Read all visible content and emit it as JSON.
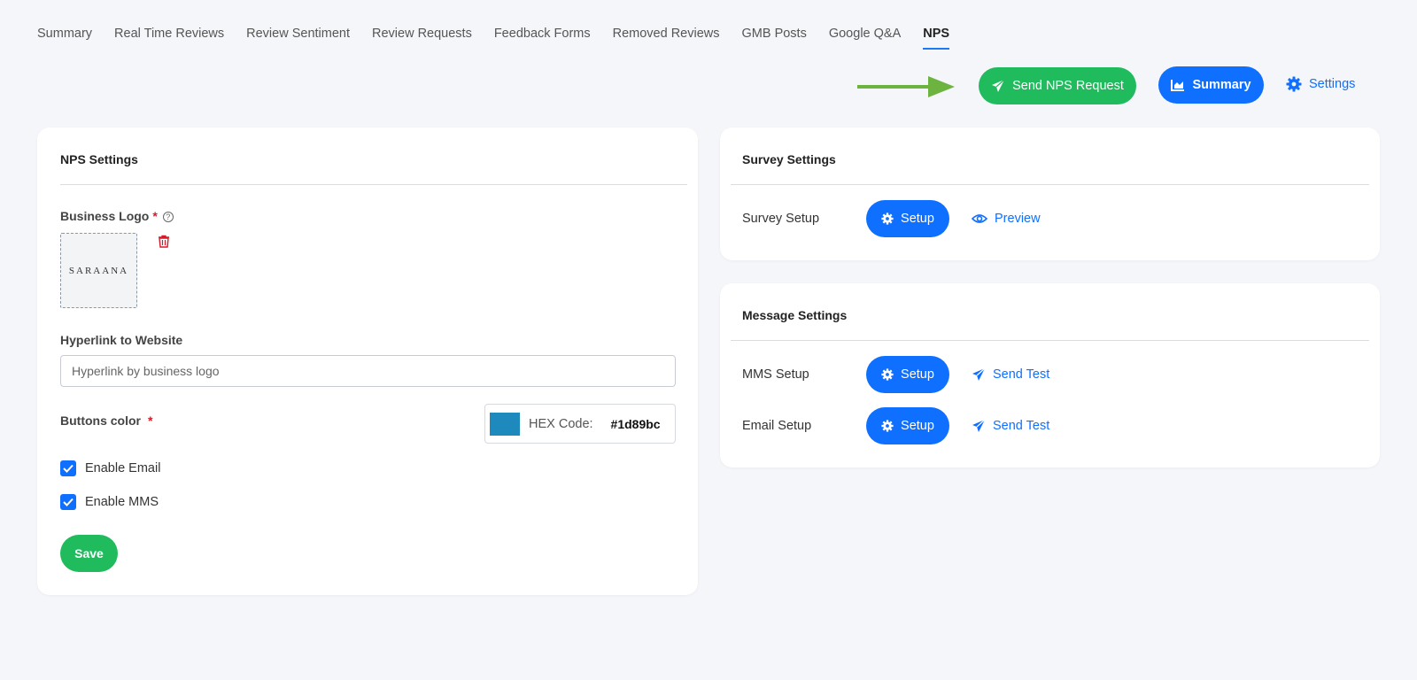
{
  "tabs": [
    {
      "label": "Summary"
    },
    {
      "label": "Real Time Reviews"
    },
    {
      "label": "Review Sentiment"
    },
    {
      "label": "Review Requests"
    },
    {
      "label": "Feedback Forms"
    },
    {
      "label": "Removed Reviews"
    },
    {
      "label": "GMB Posts"
    },
    {
      "label": "Google Q&A"
    },
    {
      "label": "NPS",
      "active": true
    }
  ],
  "actions": {
    "send_nps_label": "Send NPS Request",
    "summary_label": "Summary",
    "settings_label": "Settings"
  },
  "nps_settings": {
    "title": "NPS Settings",
    "business_logo_label": "Business Logo",
    "required_mark": "*",
    "help_glyph": "?",
    "logo_text": "SARAANA",
    "hyperlink_label": "Hyperlink to Website",
    "hyperlink_placeholder": "Hyperlink by business logo",
    "hyperlink_value": "",
    "buttons_color_label": "Buttons color",
    "hex_label": "HEX Code:",
    "hex_value": "#1d89bc",
    "enable_email_label": "Enable Email",
    "enable_email_checked": true,
    "enable_mms_label": "Enable MMS",
    "enable_mms_checked": true,
    "save_label": "Save"
  },
  "survey_settings": {
    "title": "Survey Settings",
    "survey_setup_label": "Survey Setup",
    "setup_label": "Setup",
    "preview_label": "Preview"
  },
  "message_settings": {
    "title": "Message Settings",
    "mms_setup_label": "MMS Setup",
    "email_setup_label": "Email Setup",
    "setup_label": "Setup",
    "send_test_label": "Send Test"
  },
  "colors": {
    "primary_blue": "#0f6fff",
    "green": "#1fbb5c",
    "arrow_green": "#6db33f",
    "required_red": "#d71a2b",
    "swatch": "#1d89bc"
  },
  "icons": {
    "send": "paper-plane-icon",
    "summary": "chart-icon",
    "settings": "gear-icon",
    "preview": "eye-icon",
    "delete": "trash-icon",
    "pointer_arrow": "arrow-right-icon"
  }
}
